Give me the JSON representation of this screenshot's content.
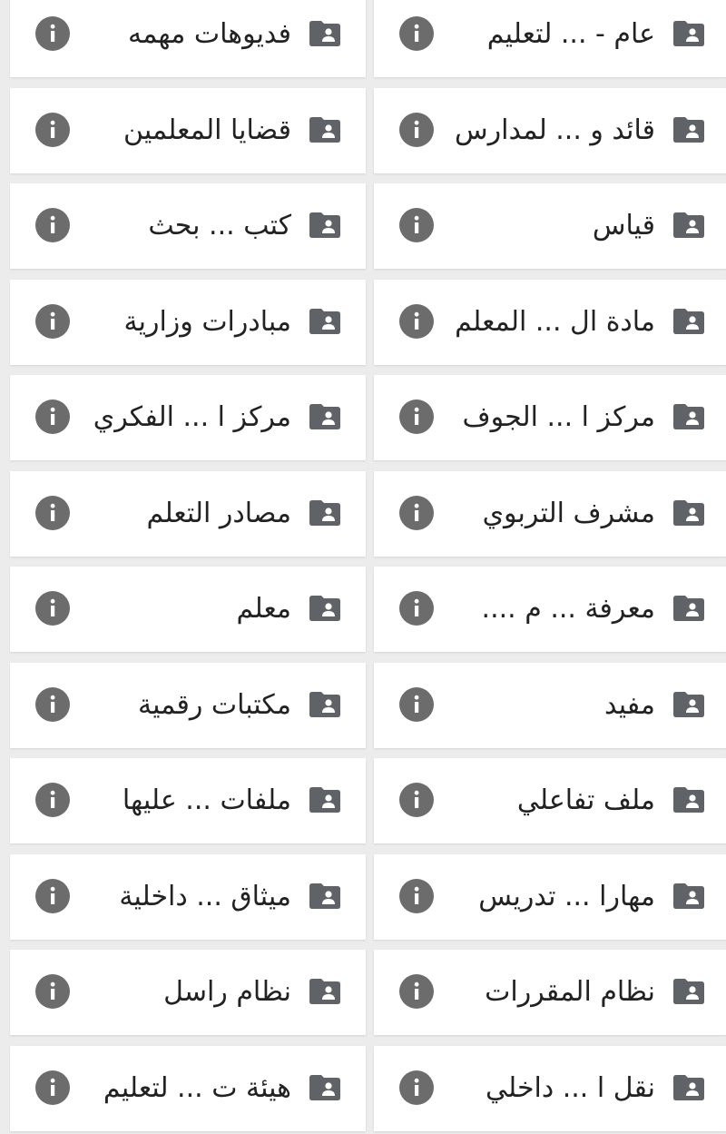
{
  "colors": {
    "background": "#ececec",
    "card": "#ffffff",
    "text": "#222222",
    "icon": "#5f6368",
    "info_icon": "#6c6c6c"
  },
  "icons": {
    "folder": "shared-folder-icon",
    "info": "info-icon"
  },
  "rows": [
    {
      "right": {
        "name": "عام - ... لتعليم"
      },
      "left": {
        "name": "فديوهات مهمه"
      }
    },
    {
      "right": {
        "name": "قائد و ... لمدارس"
      },
      "left": {
        "name": "قضايا المعلمين"
      }
    },
    {
      "right": {
        "name": "قياس"
      },
      "left": {
        "name": "كتب ... بحث"
      }
    },
    {
      "right": {
        "name": "مادة ال ... المعلم"
      },
      "left": {
        "name": "مبادرات وزارية"
      }
    },
    {
      "right": {
        "name": "مركز ا ... الجوف"
      },
      "left": {
        "name": "مركز ا ... الفكري"
      }
    },
    {
      "right": {
        "name": "مشرف التربوي"
      },
      "left": {
        "name": "مصادر التعلم"
      }
    },
    {
      "right": {
        "name": "معرفة ... م ...."
      },
      "left": {
        "name": "معلم"
      }
    },
    {
      "right": {
        "name": "مفيد"
      },
      "left": {
        "name": "مكتبات رقمية"
      }
    },
    {
      "right": {
        "name": "ملف تفاعلي"
      },
      "left": {
        "name": "ملفات ... عليها"
      }
    },
    {
      "right": {
        "name": "مهارا ... تدريس"
      },
      "left": {
        "name": "ميثاق ... داخلية"
      }
    },
    {
      "right": {
        "name": "نظام المقررات"
      },
      "left": {
        "name": "نظام راسل"
      }
    },
    {
      "right": {
        "name": "نقل ا ... داخلي"
      },
      "left": {
        "name": "هيئة ت ... لتعليم"
      }
    }
  ]
}
